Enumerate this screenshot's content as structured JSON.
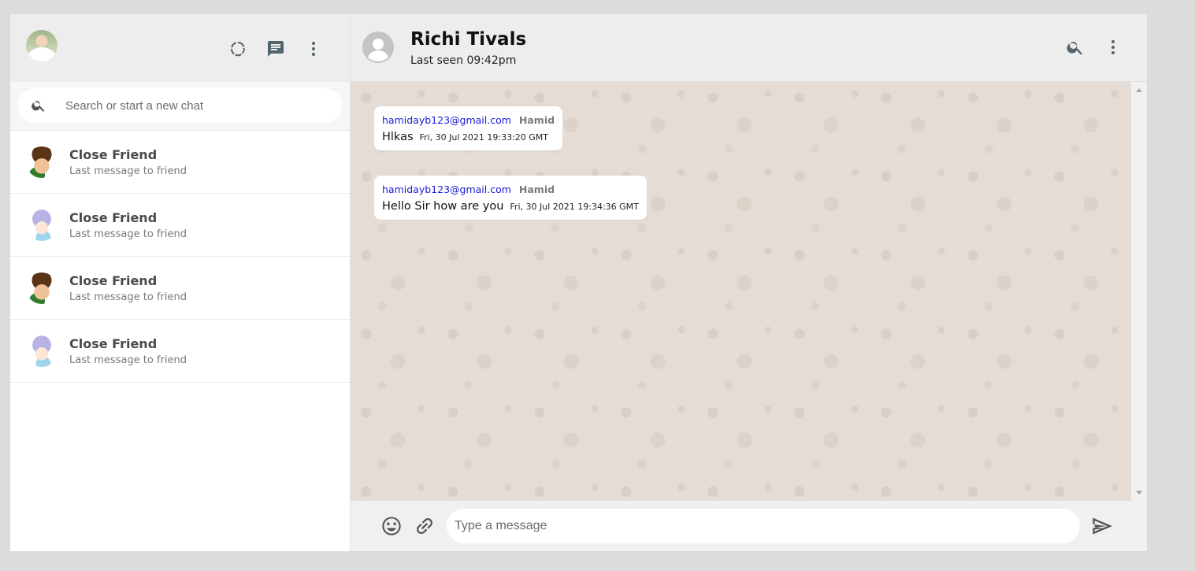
{
  "sidebar": {
    "search_placeholder": "Search or start a new chat",
    "chats": [
      {
        "name": "Close Friend",
        "last": "Last message to friend",
        "avatar": "ben-avatar"
      },
      {
        "name": "Close Friend",
        "last": "Last message to friend",
        "avatar": "girl-avatar"
      },
      {
        "name": "Close Friend",
        "last": "Last message to friend",
        "avatar": "ben-avatar"
      },
      {
        "name": "Close Friend",
        "last": "Last message to friend",
        "avatar": "girl-avatar"
      }
    ],
    "icons": [
      "status-icon",
      "new-chat-icon",
      "menu-icon"
    ]
  },
  "chat": {
    "contact_name": "Richi Tivals",
    "contact_status": "Last seen 09:42pm",
    "messages": [
      {
        "email": "hamidayb123@gmail.com",
        "sender": "Hamid",
        "text": "Hlkas",
        "time": "Fri, 30 Jul 2021 19:33:20 GMT"
      },
      {
        "email": "hamidayb123@gmail.com",
        "sender": "Hamid",
        "text": "Hello Sir how are you",
        "time": "Fri, 30 Jul 2021 19:34:36 GMT"
      }
    ],
    "input_placeholder": "Type a message",
    "icons": [
      "search-icon",
      "menu-icon",
      "emoji-icon",
      "attach-icon",
      "send-icon"
    ]
  },
  "colors": {
    "header_bg": "#ededed",
    "chat_bg": "#e5ddd5",
    "email_link": "#1a1ad8"
  }
}
